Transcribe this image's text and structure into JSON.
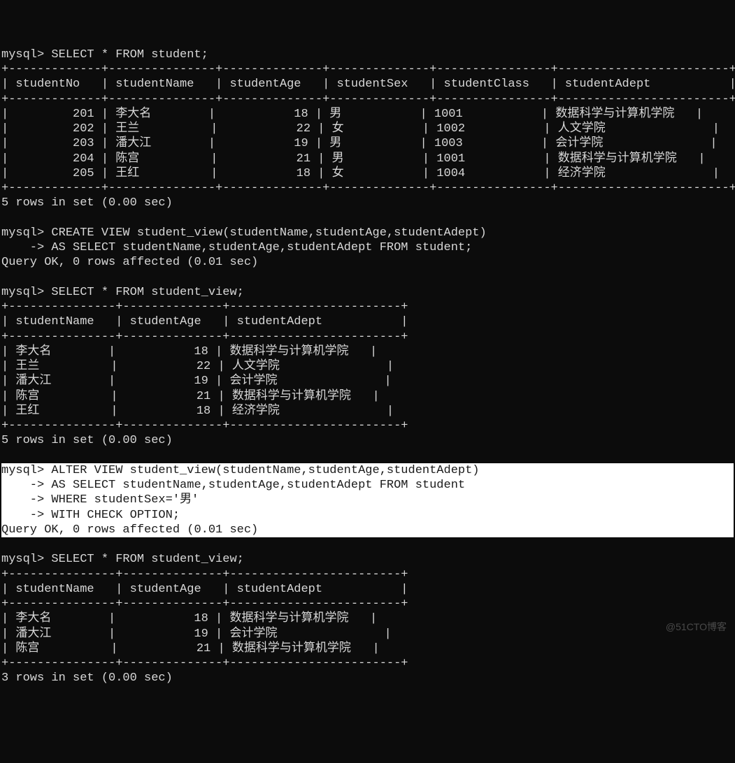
{
  "prompt": "mysql>",
  "cont_prompt": "    ->",
  "queries": {
    "q1": "SELECT * FROM student;",
    "q2a": "CREATE VIEW student_view(studentName,studentAge,studentAdept)",
    "q2b": "AS SELECT studentName,studentAge,studentAdept FROM student;",
    "q3": "SELECT * FROM student_view;",
    "q4a": "ALTER VIEW student_view(studentName,studentAge,studentAdept)",
    "q4b": "AS SELECT studentName,studentAge,studentAdept FROM student",
    "q4c": "WHERE studentSex='男'",
    "q4d": "WITH CHECK OPTION;",
    "q5": "SELECT * FROM student_view;"
  },
  "status": {
    "rows5": "5 rows in set (0.00 sec)",
    "rows3": "3 rows in set (0.00 sec)",
    "ok": "Query OK, 0 rows affected (0.01 sec)"
  },
  "table1": {
    "headers": [
      "studentNo",
      "studentName",
      "studentAge",
      "studentSex",
      "studentClass",
      "studentAdept"
    ],
    "rows": [
      {
        "no": "201",
        "name": "李大名",
        "age": "18",
        "sex": "男",
        "class": "1001",
        "adept": "数据科学与计算机学院"
      },
      {
        "no": "202",
        "name": "王兰",
        "age": "22",
        "sex": "女",
        "class": "1002",
        "adept": "人文学院"
      },
      {
        "no": "203",
        "name": "潘大江",
        "age": "19",
        "sex": "男",
        "class": "1003",
        "adept": "会计学院"
      },
      {
        "no": "204",
        "name": "陈宫",
        "age": "21",
        "sex": "男",
        "class": "1001",
        "adept": "数据科学与计算机学院"
      },
      {
        "no": "205",
        "name": "王红",
        "age": "18",
        "sex": "女",
        "class": "1004",
        "adept": "经济学院"
      }
    ]
  },
  "table2": {
    "headers": [
      "studentName",
      "studentAge",
      "studentAdept"
    ],
    "rows": [
      {
        "name": "李大名",
        "age": "18",
        "adept": "数据科学与计算机学院"
      },
      {
        "name": "王兰",
        "age": "22",
        "adept": "人文学院"
      },
      {
        "name": "潘大江",
        "age": "19",
        "adept": "会计学院"
      },
      {
        "name": "陈宫",
        "age": "21",
        "adept": "数据科学与计算机学院"
      },
      {
        "name": "王红",
        "age": "18",
        "adept": "经济学院"
      }
    ]
  },
  "table3": {
    "headers": [
      "studentName",
      "studentAge",
      "studentAdept"
    ],
    "rows": [
      {
        "name": "李大名",
        "age": "18",
        "adept": "数据科学与计算机学院"
      },
      {
        "name": "潘大江",
        "age": "19",
        "adept": "会计学院"
      },
      {
        "name": "陈宫",
        "age": "21",
        "adept": "数据科学与计算机学院"
      }
    ]
  },
  "watermark": "@51CTO博客"
}
